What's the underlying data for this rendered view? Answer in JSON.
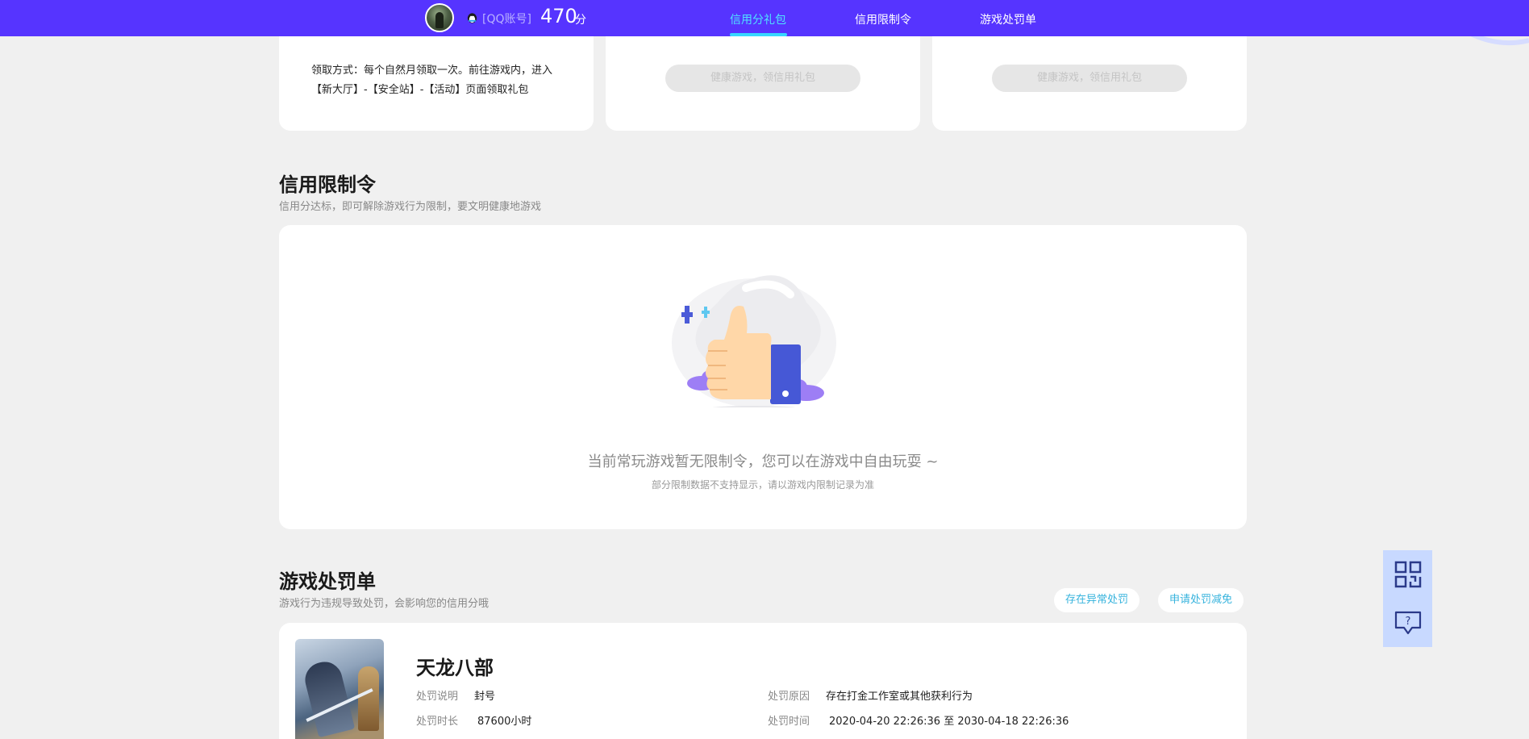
{
  "header": {
    "account_label": "[QQ账号]",
    "score": "470",
    "score_unit": "分",
    "nav": [
      {
        "label": "信用分礼包",
        "active": true
      },
      {
        "label": "信用限制令",
        "active": false
      },
      {
        "label": "游戏处罚单",
        "active": false
      }
    ]
  },
  "gift_cards": {
    "claim_text": "领取方式：每个自然月领取一次。前往游戏内，进入【新大厅】-【安全站】-【活动】页面领取礼包",
    "button_label": "健康游戏，领信用礼包"
  },
  "restriction": {
    "title": "信用限制令",
    "subtitle": "信用分达标，即可解除游戏行为限制，要文明健康地游戏",
    "empty_main": "当前常玩游戏暂无限制令，您可以在游戏中自由玩耍 ~",
    "empty_sub": "部分限制数据不支持显示，请以游戏内限制记录为准"
  },
  "penalty": {
    "title": "游戏处罚单",
    "subtitle": "游戏行为违规导致处罚，会影响您的信用分哦",
    "btn_abnormal": "存在异常处罚",
    "btn_reduce": "申请处罚减免",
    "game_name": "天龙八部",
    "labels": {
      "desc": "处罚说明",
      "duration": "处罚时长",
      "reason": "处罚原因",
      "time": "处罚时间"
    },
    "values": {
      "desc": "封号",
      "duration": "87600小时",
      "reason": "存在打金工作室或其他获利行为",
      "time": "2020-04-20 22:26:36 至 2030-04-18 22:26:36"
    }
  },
  "colors": {
    "topbar": "#5634ff",
    "nav_active": "#4fe3ff",
    "pill_text": "#36b3dd",
    "side_tool": "#c8d9ff"
  },
  "icons": [
    "qq-penguin-icon",
    "thumbs-up-illustration",
    "qr-code-icon",
    "feedback-question-icon"
  ]
}
